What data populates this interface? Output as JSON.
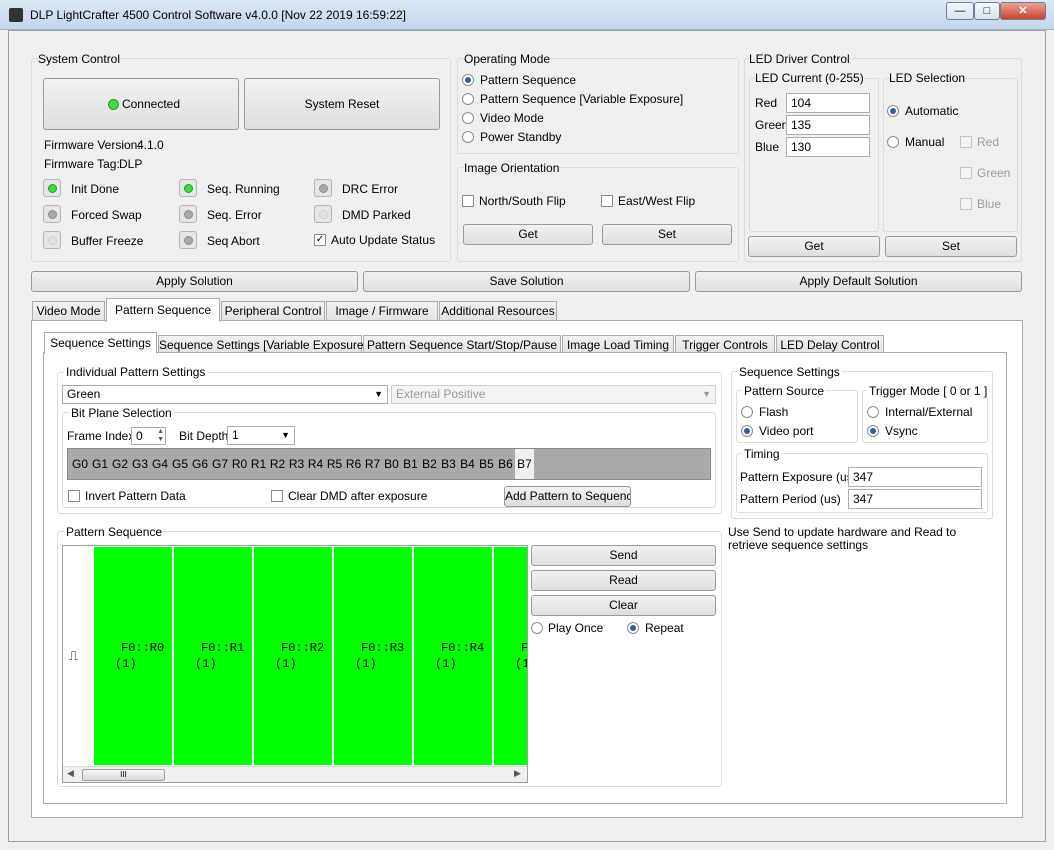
{
  "window": {
    "title": "DLP LightCrafter 4500 Control Software v4.0.0 [Nov 22 2019 16:59:22]",
    "minimize": "—",
    "maximize": "□",
    "close": "✕"
  },
  "system_control": {
    "label": "System Control",
    "connected_label": "Connected",
    "reset_label": "System Reset",
    "firmware_version_label": "Firmware Version:",
    "firmware_version": "4.1.0",
    "firmware_tag_label": "Firmware Tag:",
    "firmware_tag": "DLP",
    "status": [
      {
        "label": "Init Done",
        "state": "on"
      },
      {
        "label": "Seq. Running",
        "state": "on"
      },
      {
        "label": "DRC Error",
        "state": "off"
      },
      {
        "label": "Forced Swap",
        "state": "off"
      },
      {
        "label": "Seq. Error",
        "state": "off"
      },
      {
        "label": "DMD Parked",
        "state": "dim"
      },
      {
        "label": "Buffer Freeze",
        "state": "dim"
      },
      {
        "label": "Seq Abort",
        "state": "off"
      }
    ],
    "auto_update_label": "Auto Update Status",
    "auto_update_checked": true
  },
  "operating_mode": {
    "label": "Operating Mode",
    "options": [
      "Pattern Sequence",
      "Pattern Sequence [Variable Exposure]",
      "Video Mode",
      "Power Standby"
    ],
    "selected": 0
  },
  "image_orientation": {
    "label": "Image Orientation",
    "ns_flip": "North/South Flip",
    "ew_flip": "East/West Flip",
    "get": "Get",
    "set": "Set"
  },
  "led_driver": {
    "label": "LED Driver Control",
    "current_label": "LED Current (0-255)",
    "red_label": "Red",
    "red": "104",
    "green_label": "Green",
    "green": "135",
    "blue_label": "Blue",
    "blue": "130",
    "selection_label": "LED Selection",
    "automatic": "Automatic",
    "manual": "Manual",
    "red_cb": "Red",
    "green_cb": "Green",
    "blue_cb": "Blue",
    "get": "Get",
    "set": "Set"
  },
  "solution": {
    "apply": "Apply Solution",
    "save": "Save Solution",
    "apply_default": "Apply Default Solution"
  },
  "main_tabs": [
    "Video Mode",
    "Pattern Sequence",
    "Peripheral Control",
    "Image / Firmware",
    "Additional Resources"
  ],
  "sub_tabs": [
    "Sequence Settings",
    "Sequence Settings [Variable Exposure]",
    "Pattern Sequence Start/Stop/Pause",
    "Image Load Timing",
    "Trigger Controls",
    "LED Delay Control"
  ],
  "individual": {
    "label": "Individual Pattern Settings",
    "color": "Green",
    "trigger": "External Positive",
    "bitplane_label": "Bit Plane Selection",
    "frame_index_label": "Frame Index",
    "frame_index": "0",
    "bit_depth_label": "Bit Depth",
    "bit_depth": "1",
    "bits": [
      "G0",
      "G1",
      "G2",
      "G3",
      "G4",
      "G5",
      "G6",
      "G7",
      "R0",
      "R1",
      "R2",
      "R3",
      "R4",
      "R5",
      "R6",
      "R7",
      "B0",
      "B1",
      "B2",
      "B3",
      "B4",
      "B5",
      "B6",
      "B7"
    ],
    "invert_label": "Invert Pattern Data",
    "clear_label": "Clear DMD after exposure",
    "add_label": "Add Pattern to Sequence"
  },
  "sequence_settings": {
    "label": "Sequence Settings",
    "source_label": "Pattern Source",
    "flash": "Flash",
    "video_port": "Video port",
    "trigger_label": "Trigger Mode [ 0 or 1 ]",
    "internal": "Internal/External",
    "vsync": "Vsync",
    "timing_label": "Timing",
    "exposure_label": "Pattern Exposure (us)",
    "exposure": "347",
    "period_label": "Pattern Period (us)",
    "period": "347"
  },
  "pattern_sequence": {
    "label": "Pattern Sequence",
    "trigger_icon": "⎍",
    "cells": [
      {
        "name": "F0::R0",
        "count": "(1)"
      },
      {
        "name": "F0::R1",
        "count": "(1)"
      },
      {
        "name": "F0::R2",
        "count": "(1)"
      },
      {
        "name": "F0::R3",
        "count": "(1)"
      },
      {
        "name": "F0::R4",
        "count": "(1)"
      },
      {
        "name": "F",
        "count": "(1"
      }
    ],
    "send": "Send",
    "read": "Read",
    "clear": "Clear",
    "play_once": "Play Once",
    "repeat": "Repeat",
    "scroll_grip": "III"
  },
  "hint": "Use Send to update hardware and Read to retrieve sequence settings",
  "colors": {
    "led_on": "#3fdc3f",
    "pattern_cell": "#00ff00"
  }
}
